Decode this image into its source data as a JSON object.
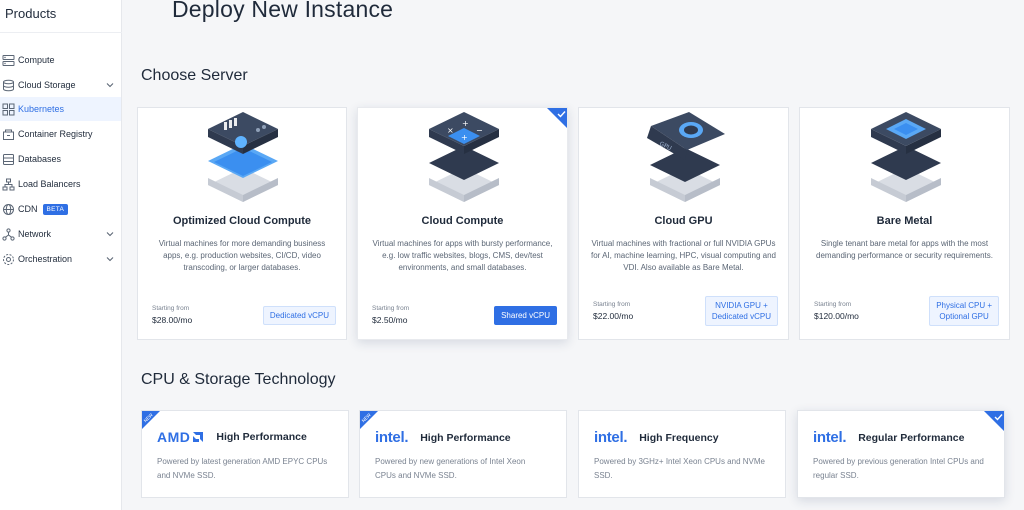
{
  "sidebar": {
    "title": "Products",
    "items": [
      {
        "label": "Compute",
        "icon": "server-icon"
      },
      {
        "label": "Cloud Storage",
        "icon": "storage-icon",
        "expandable": true
      },
      {
        "label": "Kubernetes",
        "icon": "kubernetes-icon",
        "active": true
      },
      {
        "label": "Container Registry",
        "icon": "registry-icon"
      },
      {
        "label": "Databases",
        "icon": "database-icon"
      },
      {
        "label": "Load Balancers",
        "icon": "load-balancer-icon"
      },
      {
        "label": "CDN",
        "icon": "cdn-icon",
        "badge": "BETA"
      },
      {
        "label": "Network",
        "icon": "network-icon",
        "expandable": true
      },
      {
        "label": "Orchestration",
        "icon": "orchestration-icon",
        "expandable": true
      }
    ]
  },
  "page": {
    "title": "Deploy New Instance"
  },
  "choose_server": {
    "title": "Choose Server",
    "cards": [
      {
        "title": "Optimized Cloud Compute",
        "description": "Virtual machines for more demanding business apps, e.g. production websites, CI/CD, video transcoding, or larger databases.",
        "starting_label": "Starting from",
        "price": "$28.00/mo",
        "tag": "Dedicated vCPU",
        "illustration": "optimized-compute-illustration"
      },
      {
        "title": "Cloud Compute",
        "description": "Virtual machines for apps with bursty performance, e.g. low traffic websites, blogs, CMS, dev/test environments, and small databases.",
        "starting_label": "Starting from",
        "price": "$2.50/mo",
        "tag": "Shared vCPU",
        "selected": true,
        "illustration": "cloud-compute-illustration"
      },
      {
        "title": "Cloud GPU",
        "description": "Virtual machines with fractional or full NVIDIA GPUs for AI, machine learning, HPC, visual computing and VDI. Also available as Bare Metal.",
        "starting_label": "Starting from",
        "price": "$22.00/mo",
        "tag_line1": "NVIDIA GPU +",
        "tag_line2": "Dedicated vCPU",
        "illustration": "gpu-illustration",
        "illustration_text": "GPU"
      },
      {
        "title": "Bare Metal",
        "description": "Single tenant bare metal for apps with the most demanding performance or security requirements.",
        "starting_label": "Starting from",
        "price": "$120.00/mo",
        "tag_line1": "Physical CPU +",
        "tag_line2": "Optional GPU",
        "illustration": "bare-metal-illustration"
      }
    ]
  },
  "cpu_storage": {
    "title": "CPU & Storage Technology",
    "cards": [
      {
        "brand": "AMD",
        "name": "High Performance",
        "description": "Powered by latest generation AMD EPYC CPUs and NVMe SSD.",
        "new_badge": "NEW"
      },
      {
        "brand": "intel.",
        "name": "High Performance",
        "description": "Powered by new generations of Intel Xeon CPUs and NVMe SSD.",
        "new_badge": "NEW"
      },
      {
        "brand": "intel.",
        "name": "High Frequency",
        "description": "Powered by 3GHz+ Intel Xeon CPUs and NVMe SSD."
      },
      {
        "brand": "intel.",
        "name": "Regular Performance",
        "description": "Powered by previous generation Intel CPUs and regular SSD.",
        "selected": true
      }
    ]
  },
  "colors": {
    "accent": "#2f6fe4",
    "illustration_dark": "#2f3a4f",
    "illustration_blue": "#3b8ff0"
  }
}
